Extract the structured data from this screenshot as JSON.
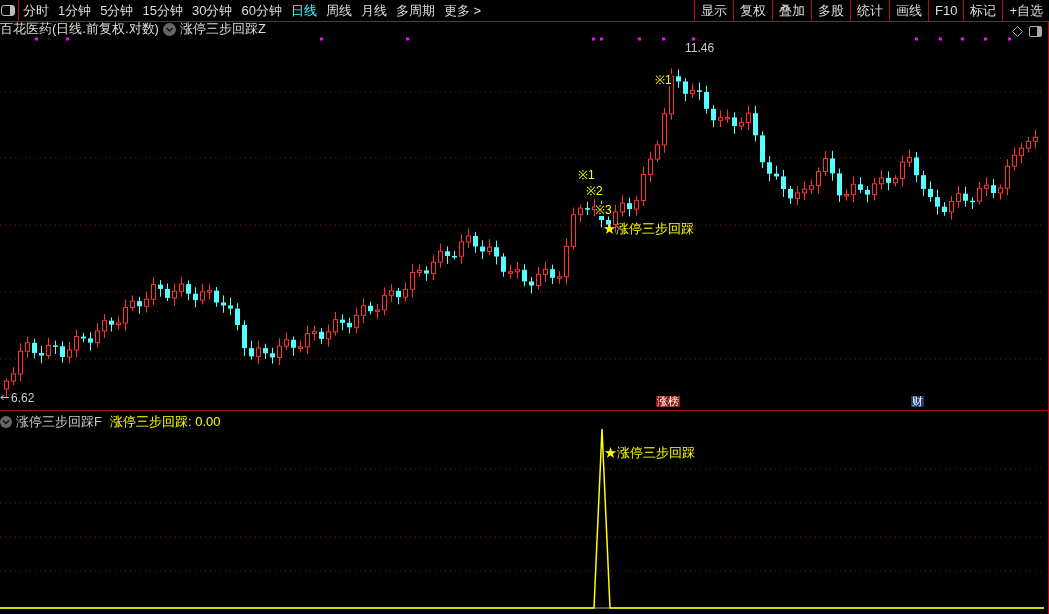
{
  "toolbar": {
    "tabs": [
      {
        "label": "分时",
        "selected": false
      },
      {
        "label": "1分钟",
        "selected": false
      },
      {
        "label": "5分钟",
        "selected": false
      },
      {
        "label": "15分钟",
        "selected": false
      },
      {
        "label": "30分钟",
        "selected": false
      },
      {
        "label": "60分钟",
        "selected": false
      },
      {
        "label": "日线",
        "selected": true
      },
      {
        "label": "周线",
        "selected": false
      },
      {
        "label": "月线",
        "selected": false
      },
      {
        "label": "多周期",
        "selected": false
      },
      {
        "label": "更多 >",
        "selected": false
      }
    ],
    "buttons": [
      "显示",
      "复权",
      "叠加",
      "多股",
      "统计",
      "画线",
      "F10",
      "标记",
      "+自选"
    ]
  },
  "main_panel": {
    "stock_title": "百花医药(日线.前复权.对数)",
    "indicator": "涨停三步回踩Z",
    "high_label": "11.46",
    "low_label": "6.62",
    "signals": [
      "※1",
      "※2",
      "※3",
      "※1"
    ],
    "signal_label": "★涨停三步回踩",
    "badges": [
      {
        "label": "涨榜",
        "color": "#8b1a10"
      },
      {
        "label": "财",
        "color": "#1a3f6e"
      }
    ]
  },
  "sub_panel": {
    "indicator": "涨停三步回踩F",
    "value_name": "涨停三步回踩:",
    "value": "0.00",
    "signal_label": "★涨停三步回踩"
  }
}
